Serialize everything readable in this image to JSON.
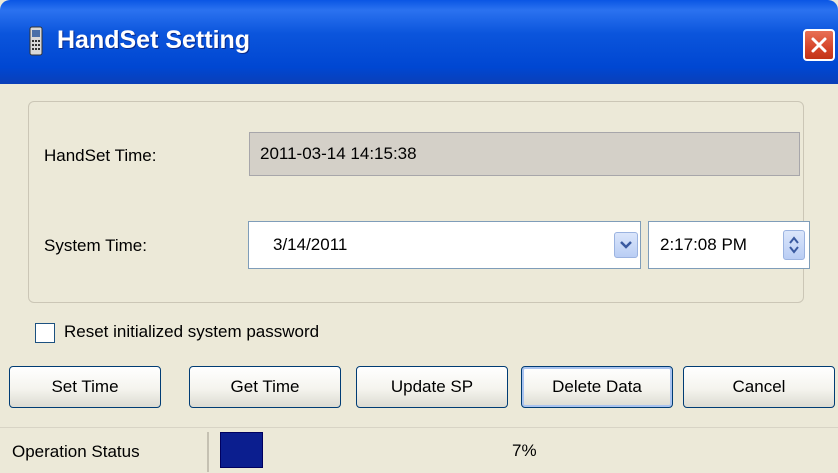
{
  "window": {
    "title": "HandSet Setting",
    "icon": "handset-icon",
    "close_icon": "close-icon"
  },
  "form": {
    "handset_time_label": "HandSet Time:",
    "handset_time_value": "2011-03-14 14:15:38",
    "system_time_label": "System Time:",
    "system_date_value": "3/14/2011",
    "system_time_value": "2:17:08 PM"
  },
  "options": {
    "reset_password_label": "Reset initialized system password",
    "reset_password_checked": false
  },
  "buttons": {
    "set_time": "Set Time",
    "get_time": "Get Time",
    "update_sp": "Update SP",
    "delete_data": "Delete Data",
    "cancel": "Cancel"
  },
  "status": {
    "label": "Operation Status",
    "progress_text": "7%",
    "progress_fraction": 0.07
  },
  "colors": {
    "titlebar": "#0054e3",
    "progress_fill": "#0b1e8f",
    "close_button": "#d6452a"
  }
}
